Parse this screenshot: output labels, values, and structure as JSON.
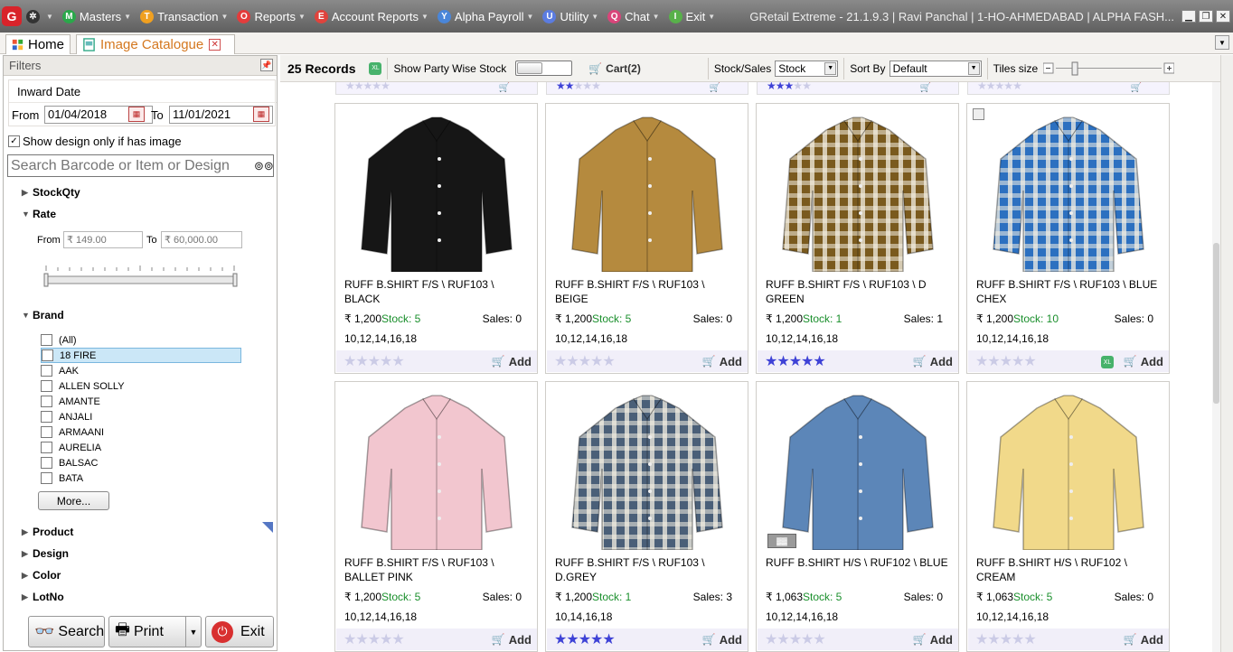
{
  "app": {
    "logo_letter": "G",
    "window_title": "GRetail Extreme - 21.1.9.3 | Ravi Panchal | 1-HO-AHMEDABAD | ALPHA FASH..."
  },
  "menu": [
    {
      "label": "",
      "icon": "tools-icon",
      "color": "#333333",
      "letter": "✲"
    },
    {
      "label": "Masters",
      "icon": "masters-icon",
      "color": "#2aa84a",
      "letter": "M"
    },
    {
      "label": "Transaction",
      "icon": "transaction-icon",
      "color": "#f0a020",
      "letter": "T"
    },
    {
      "label": "Reports",
      "icon": "reports-icon",
      "color": "#e33c3c",
      "letter": "O"
    },
    {
      "label": "Account Reports",
      "icon": "account-reports-icon",
      "color": "#e0433c",
      "letter": "E"
    },
    {
      "label": "Alpha Payroll",
      "icon": "alpha-payroll-icon",
      "color": "#4a86d9",
      "letter": "Y"
    },
    {
      "label": "Utility",
      "icon": "utility-icon",
      "color": "#5b7ce0",
      "letter": "U"
    },
    {
      "label": "Chat",
      "icon": "chat-icon",
      "color": "#d9457a",
      "letter": "Q"
    },
    {
      "label": "Exit",
      "icon": "exit-icon",
      "color": "#58b14a",
      "letter": "I"
    }
  ],
  "tabs": {
    "home": "Home",
    "catalogue": "Image Catalogue"
  },
  "filters": {
    "header": "Filters",
    "inward_date_label": "Inward Date",
    "from_label": "From",
    "from_value": "01/04/2018",
    "to_label": "To",
    "to_value": "11/01/2021",
    "design_only_label": "Show design only if has image",
    "search_placeholder": "Search Barcode or Item or Design",
    "sections": {
      "stockqty": "StockQty",
      "rate": "Rate",
      "brand": "Brand",
      "product": "Product",
      "design": "Design",
      "color": "Color",
      "lotno": "LotNo"
    },
    "rate_from_label": "From",
    "rate_from_placeholder": "₹ 149.00",
    "rate_to_label": "To",
    "rate_to_placeholder": "₹ 60,000.00",
    "brands": [
      "(All)",
      "18 FIRE",
      "AAK",
      "ALLEN SOLLY",
      "AMANTE",
      "ANJALI",
      "ARMAANI",
      "AURELIA",
      "BALSAC",
      "BATA"
    ],
    "more_label": "More..."
  },
  "buttons": {
    "search": "Search",
    "print": "Print",
    "exit": "Exit"
  },
  "toolbar": {
    "records": "25 Records",
    "party_stock_label": "Show Party Wise Stock",
    "cart_label": "Cart(2)",
    "stock_sales_label": "Stock/Sales",
    "stock_sales_value": "Stock",
    "sort_by_label": "Sort By",
    "sort_by_value": "Default",
    "tiles_size_label": "Tiles size",
    "tiles_size_level": 0.18
  },
  "grid_top_partial": [
    {
      "rating": 0
    },
    {
      "rating": 2
    },
    {
      "rating": 3
    },
    {
      "rating": 0
    }
  ],
  "tiles": [
    {
      "name": "RUFF B.SHIRT F/S \\ RUF103 \\ BLACK",
      "price": "₹ 1,200",
      "stock": "Stock: 5",
      "sales": "Sales: 0",
      "sizes": "10,12,14,16,18",
      "rating": 0,
      "add": "Add",
      "shirt_color": "#161616",
      "pattern": "solid"
    },
    {
      "name": "RUFF B.SHIRT F/S \\ RUF103 \\ BEIGE",
      "price": "₹ 1,200",
      "stock": "Stock: 5",
      "sales": "Sales: 0",
      "sizes": "10,12,14,16,18",
      "rating": 0,
      "add": "Add",
      "shirt_color": "#b58a3e",
      "pattern": "solid"
    },
    {
      "name": "RUFF B.SHIRT F/S \\ RUF103 \\ D GREEN",
      "price": "₹ 1,200",
      "stock": "Stock: 1",
      "sales": "Sales: 1",
      "sizes": "10,12,14,16,18",
      "rating": 5,
      "add": "Add",
      "shirt_color": "#7a5a1e",
      "pattern": "check"
    },
    {
      "name": "RUFF B.SHIRT F/S \\ RUF103 \\ BLUE CHEX",
      "price": "₹ 1,200",
      "stock": "Stock: 10",
      "sales": "Sales: 0",
      "sizes": "10,12,14,16,18",
      "rating": 0,
      "add": "Add",
      "shirt_color": "#2c70c0",
      "pattern": "check"
    },
    {
      "name": "RUFF B.SHIRT F/S \\ RUF103 \\ BALLET PINK",
      "price": "₹ 1,200",
      "stock": "Stock: 5",
      "sales": "Sales: 0",
      "sizes": "10,12,14,16,18",
      "rating": 0,
      "add": "Add",
      "shirt_color": "#f2c6cf",
      "pattern": "solid"
    },
    {
      "name": "RUFF B.SHIRT F/S \\ RUF103 \\ D.GREY",
      "price": "₹ 1,200",
      "stock": "Stock: 1",
      "sales": "Sales: 3",
      "sizes": "10,14,16,18",
      "rating": 5,
      "add": "Add",
      "shirt_color": "#4a5f78",
      "pattern": "check"
    },
    {
      "name": "RUFF B.SHIRT H/S \\ RUF102 \\ BLUE",
      "price": "₹ 1,063",
      "stock": "Stock: 5",
      "sales": "Sales: 0",
      "sizes": "10,12,14,16,18",
      "rating": 0,
      "add": "Add",
      "shirt_color": "#5c86b8",
      "pattern": "solid"
    },
    {
      "name": "RUFF B.SHIRT H/S \\ RUF102 \\ CREAM",
      "price": "₹ 1,063",
      "stock": "Stock: 5",
      "sales": "Sales: 0",
      "sizes": "10,12,14,16,18",
      "rating": 0,
      "add": "Add",
      "shirt_color": "#f1d98a",
      "pattern": "solid"
    }
  ]
}
